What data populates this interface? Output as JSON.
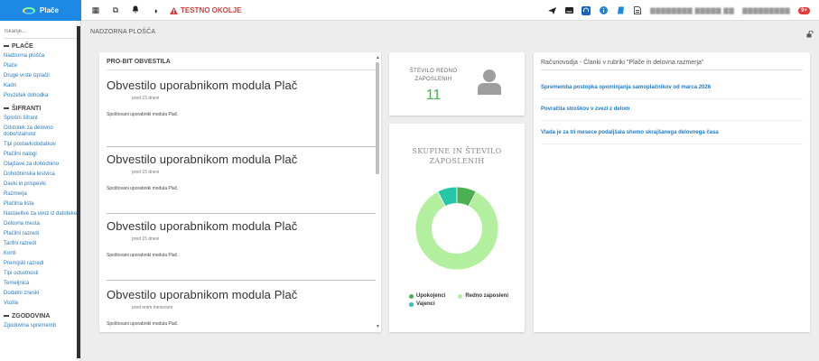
{
  "brand": {
    "name": "Plače"
  },
  "topbar": {
    "environment_label": "TESTNO OKOLJE",
    "icons_left": [
      "grid-icon",
      "external-icon",
      "bell-icon",
      "contrast-icon"
    ],
    "icons_right": [
      "send-icon",
      "keyboard-icon",
      "headset-icon",
      "info-icon",
      "book-icon",
      "document-icon"
    ],
    "user_org": "▇▇▇▇▇▇▇▇ ▇▇▇▇▇ ▇▇",
    "user_name": "▇▇▇▇▇▇▇▇▇",
    "notifications": "9+"
  },
  "sidebar": {
    "search_placeholder": "Iskanje...",
    "sections": [
      {
        "title": "PLAČE",
        "items": [
          "Nadzorna plošča",
          "Plače",
          "Druge vrste izplačil",
          "Kadri",
          "Povzetek dohodka"
        ]
      },
      {
        "title": "ŠIFRANTI",
        "items": [
          "Splošni šifrant",
          "Odstotek za delovno dobo/stalnost",
          "Tipi postavk/dodatkov",
          "Plačilni nalogi",
          "Olajšave za dohodnino",
          "Dohodninska lestvica",
          "Davki in prispevki",
          "Razmerja",
          "Plačilna lista",
          "Nastavitve za uvoz iz datoteke",
          "Delovna mesta",
          "Plačilni razredi",
          "Tarifni razredi",
          "Konti",
          "Premijski razredi",
          "Tipi odsotnosti",
          "Temeljnica",
          "Dodatni zneski",
          "Vozila"
        ]
      },
      {
        "title": "ZGODOVINA",
        "items": [
          "Zgodovina sprememb"
        ]
      }
    ]
  },
  "main": {
    "title": "NADZORNA PLOŠČA",
    "news": {
      "title": "PRO-BIT OBVESTILA",
      "posts": [
        {
          "heading": "Obvestilo uporabnikom modula Plač",
          "time": "pred 15 dnevi",
          "body": "Spoštovani uporabniki modula Plač."
        },
        {
          "heading": "Obvestilo uporabnikom modula Plač",
          "time": "pred 15 dnevi",
          "body": "Spoštovani uporabniki modula Plač."
        },
        {
          "heading": "Obvestilo uporabnikom modula Plač",
          "time": "pred 15 dnevi",
          "body": "Spoštovani uporabniki modula Plač."
        },
        {
          "heading": "Obvestilo uporabnikom modula Plač",
          "time": "pred enim mesecem",
          "body": "Spoštovani uporabniki modula Plač."
        }
      ]
    },
    "employees": {
      "label": "ŠTEVILO REDNO ZAPOSLENIH",
      "count": "11"
    },
    "groups": {
      "title": "SKUPINE IN ŠTEVILO ZAPOSLENIH"
    },
    "articles": {
      "title": "Računovodja - Članki v rubriki \"Plače in delovna razmerja\"",
      "items": [
        "Sprememba postopka opominjanja samoplačnikov od marca 2026",
        "Povračila stroškov v zvezi z delom",
        "Vlada je za tri mesece podaljšala shemo skrajšanega delovnega časa"
      ]
    }
  },
  "chart_data": {
    "type": "pie",
    "title": "SKUPINE IN ŠTEVILO ZAPOSLENIH",
    "categories": [
      "Upokojenci",
      "Redno zaposleni",
      "Vajenci"
    ],
    "values": [
      1,
      11,
      1
    ],
    "colors": [
      "#4caf50",
      "#b2f0a0",
      "#26c6a8"
    ],
    "legend": "bottom",
    "hole": 0.6
  }
}
